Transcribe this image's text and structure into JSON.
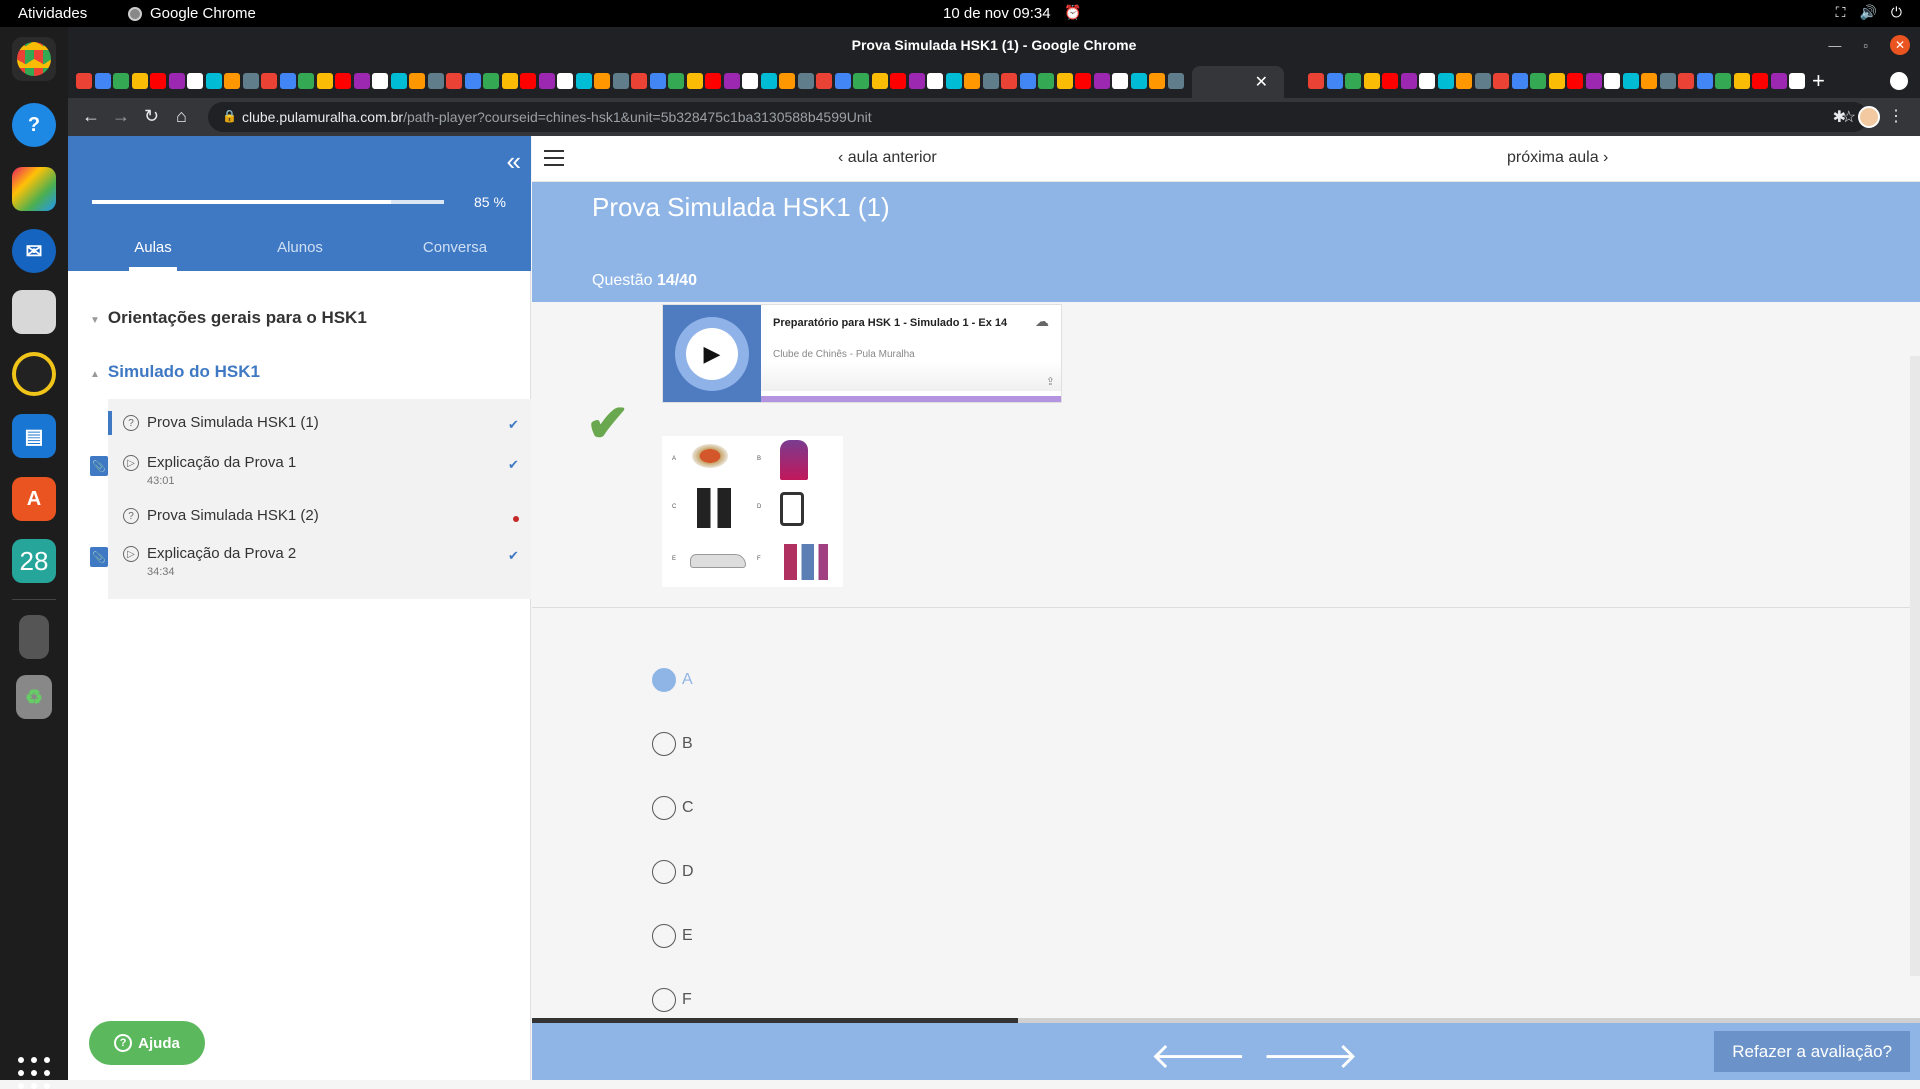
{
  "os": {
    "activities": "Atividades",
    "app_name": "Google Chrome",
    "clock": "10 de nov  09:34"
  },
  "browser": {
    "window_title": "Prova Simulada HSK1 (1) - Google Chrome",
    "url_host": "clube.pulamuralha.com.br",
    "url_path": "/path-player?courseid=chines-hsk1&unit=5b328475c1ba3130588b4599Unit"
  },
  "dock": {
    "calendar_day": "28"
  },
  "sidebar": {
    "progress_percent": 85,
    "progress_label": "85 %",
    "tabs": [
      {
        "label": "Aulas",
        "active": true
      },
      {
        "label": "Alunos",
        "active": false
      },
      {
        "label": "Conversa",
        "active": false
      }
    ],
    "sections": [
      {
        "title": "Orientações gerais para o HSK1",
        "expanded": false
      },
      {
        "title": "Simulado do HSK1",
        "expanded": true
      }
    ],
    "lessons": [
      {
        "label": "Prova Simulada HSK1 (1)",
        "duration": "",
        "status": "done",
        "type": "quiz",
        "current": true
      },
      {
        "label": "Explicação da Prova 1",
        "duration": "43:01",
        "status": "done",
        "type": "video",
        "attachment": true
      },
      {
        "label": "Prova Simulada HSK1 (2)",
        "duration": "",
        "status": "pending",
        "type": "quiz"
      },
      {
        "label": "Explicação da Prova 2",
        "duration": "34:34",
        "status": "done",
        "type": "video",
        "attachment": true
      }
    ],
    "help_label": "Ajuda"
  },
  "main": {
    "prev_label": "aula anterior",
    "next_label": "próxima aula",
    "title": "Prova Simulada HSK1 (1)",
    "question_prefix": "Questão",
    "question_counter": "14/40",
    "player": {
      "title": "Preparatório para HSK 1 - Simulado 1 - Ex 14",
      "author": "Clube de Chinês - Pula Muralha"
    },
    "image_letters": [
      "A",
      "B",
      "C",
      "D",
      "E",
      "F"
    ],
    "options": [
      {
        "label": "A",
        "selected": true
      },
      {
        "label": "B",
        "selected": false
      },
      {
        "label": "C",
        "selected": false
      },
      {
        "label": "D",
        "selected": false
      },
      {
        "label": "E",
        "selected": false
      },
      {
        "label": "F",
        "selected": false
      }
    ],
    "bottom_progress_fraction": 0.35,
    "redo_label": "Refazer a avaliação?"
  },
  "colors": {
    "sidebar_header": "#3f78c3",
    "banner": "#8fb5e6",
    "check_green": "#6aa84f",
    "help_green": "#5cb85c"
  }
}
